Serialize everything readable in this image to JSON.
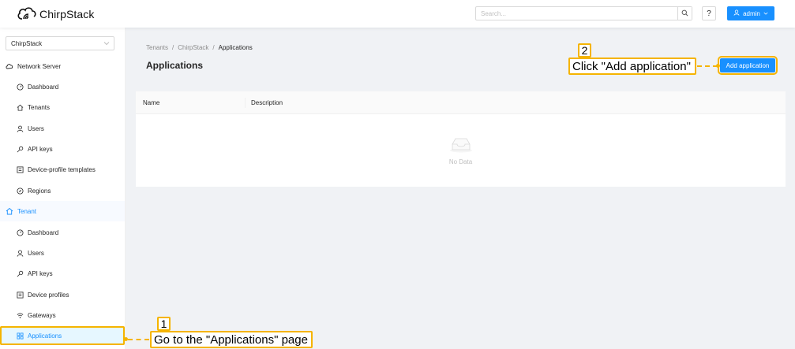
{
  "header": {
    "logo_text": "ChirpStack",
    "search_placeholder": "Search...",
    "help_label": "?",
    "user_label": "admin"
  },
  "sidebar": {
    "tenant_select_value": "ChirpStack",
    "network_server_label": "Network Server",
    "network_server_items": [
      {
        "label": "Dashboard",
        "icon": "dashboard-icon"
      },
      {
        "label": "Tenants",
        "icon": "home-icon"
      },
      {
        "label": "Users",
        "icon": "user-icon"
      },
      {
        "label": "API keys",
        "icon": "key-icon"
      },
      {
        "label": "Device-profile templates",
        "icon": "profile-icon"
      },
      {
        "label": "Regions",
        "icon": "compass-icon"
      }
    ],
    "tenant_label": "Tenant",
    "tenant_items": [
      {
        "label": "Dashboard",
        "icon": "dashboard-icon"
      },
      {
        "label": "Users",
        "icon": "user-icon"
      },
      {
        "label": "API keys",
        "icon": "key-icon"
      },
      {
        "label": "Device profiles",
        "icon": "profile-icon"
      },
      {
        "label": "Gateways",
        "icon": "wifi-icon"
      },
      {
        "label": "Applications",
        "icon": "appstore-icon"
      }
    ]
  },
  "main": {
    "breadcrumb": [
      "Tenants",
      "ChirpStack",
      "Applications"
    ],
    "breadcrumb_sep": "/",
    "title": "Applications",
    "add_button_label": "Add application",
    "table": {
      "columns": [
        "Name",
        "Description"
      ],
      "empty_text": "No Data"
    }
  },
  "annotations": {
    "step1_num": "1",
    "step1_text": "Go to the \"Applications\" page",
    "step2_num": "2",
    "step2_text": "Click \"Add application\""
  },
  "colors": {
    "primary": "#1890ff",
    "highlight": "#f5b400"
  }
}
